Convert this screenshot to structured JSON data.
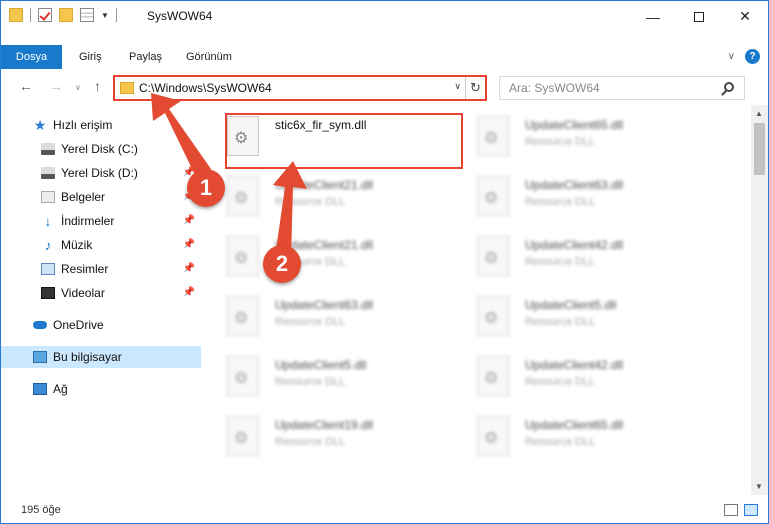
{
  "window": {
    "title": "SysWOW64",
    "minimize": "—",
    "close": "✕"
  },
  "ribbon": {
    "tabs": [
      "Dosya",
      "Giriş",
      "Paylaş",
      "Görünüm"
    ],
    "collapse": "∨",
    "help": "?"
  },
  "address_bar": {
    "path": "C:\\Windows\\SysWOW64",
    "dropdown": "∨",
    "refresh": "↻"
  },
  "nav": {
    "back": "←",
    "forward": "→",
    "recent": "∨",
    "up": "↑"
  },
  "search": {
    "placeholder": "Ara: SysWOW64"
  },
  "sidebar": {
    "items": [
      {
        "label": "Hızlı erişim",
        "icon": "star-icon",
        "pinned": false
      },
      {
        "label": "Yerel Disk (C:)",
        "icon": "drive-icon",
        "pinned": true
      },
      {
        "label": "Yerel Disk (D:)",
        "icon": "drive-icon",
        "pinned": true
      },
      {
        "label": "Belgeler",
        "icon": "documents-icon",
        "pinned": true
      },
      {
        "label": "İndirmeler",
        "icon": "downloads-icon",
        "pinned": true
      },
      {
        "label": "Müzik",
        "icon": "music-icon",
        "pinned": true
      },
      {
        "label": "Resimler",
        "icon": "pictures-icon",
        "pinned": true
      },
      {
        "label": "Videolar",
        "icon": "videos-icon",
        "pinned": true
      },
      {
        "label": "OneDrive",
        "icon": "cloud-icon",
        "pinned": false
      },
      {
        "label": "Bu bilgisayar",
        "icon": "computer-icon",
        "pinned": false
      },
      {
        "label": "Ağ",
        "icon": "network-icon",
        "pinned": false
      }
    ],
    "pin_glyph": "📌"
  },
  "files": {
    "left_column": [
      {
        "name": "stic6x_fir_sym.dll",
        "type": ""
      },
      {
        "name": "UpdateClient21.dll",
        "type": "Resource DLL"
      },
      {
        "name": "UpdateClient21.dll",
        "type": "Resource DLL"
      },
      {
        "name": "UpdateClient63.dll",
        "type": "Resource DLL"
      },
      {
        "name": "UpdateClient5.dll",
        "type": "Resource DLL"
      },
      {
        "name": "UpdateClient19.dll",
        "type": "Resource DLL"
      }
    ],
    "right_column": [
      {
        "name": "UpdateClient65.dll",
        "type": "Resource DLL"
      },
      {
        "name": "UpdateClient63.dll",
        "type": "Resource DLL"
      },
      {
        "name": "UpdateClient42.dll",
        "type": "Resource DLL"
      },
      {
        "name": "UpdateClient5.dll",
        "type": "Resource DLL"
      },
      {
        "name": "UpdateClient42.dll",
        "type": "Resource DLL"
      },
      {
        "name": "UpdateClient65.dll",
        "type": "Resource DLL"
      }
    ]
  },
  "status": {
    "item_count": "195 öğe"
  },
  "callouts": [
    "1",
    "2"
  ],
  "colors": {
    "accent": "#1979ca",
    "highlight": "#e8412e",
    "callout": "#e24a32",
    "selected": "#cce8ff"
  }
}
